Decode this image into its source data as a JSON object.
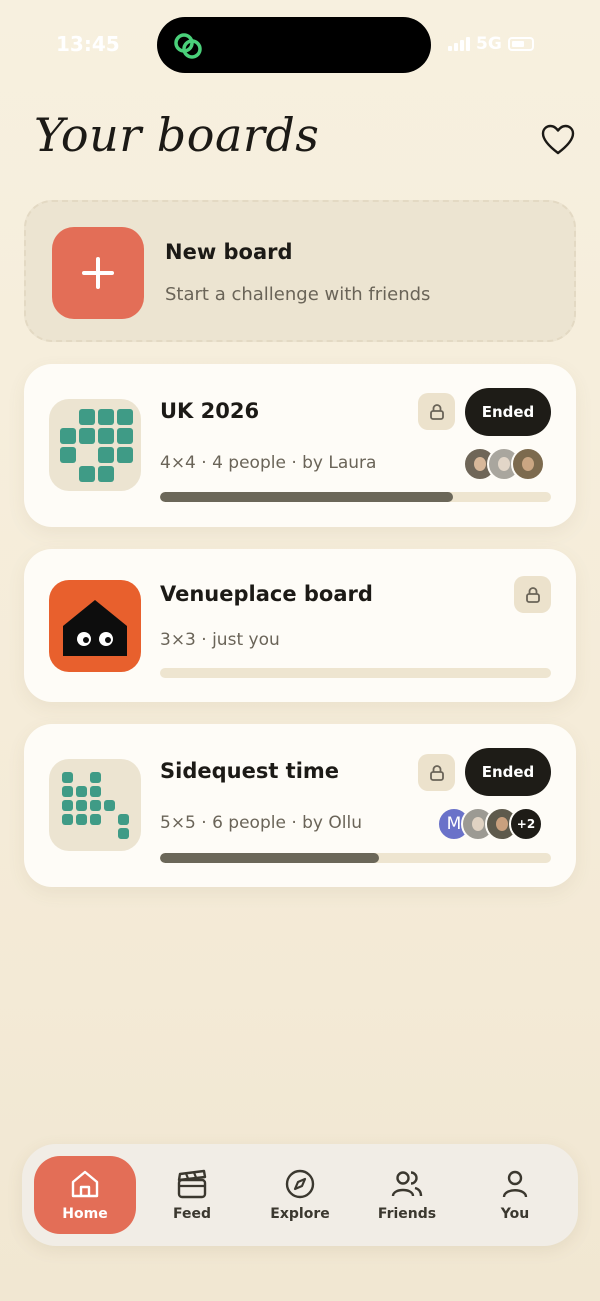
{
  "status": {
    "time": "13:45",
    "network": "5G"
  },
  "header": {
    "title": "Your boards"
  },
  "new_board": {
    "title": "New board",
    "subtitle": "Start a challenge with friends"
  },
  "boards": [
    {
      "title": "UK 2026",
      "meta": "4×4 · 4 people · by Laura",
      "status": "Ended",
      "progress": 0.75,
      "avatars": [
        "photo",
        "photo",
        "photo"
      ]
    },
    {
      "title": "Venueplace board",
      "meta": "3×3 · just you",
      "progress": 0.0
    },
    {
      "title": "Sidequest time",
      "meta": "5×5 · 6 people · by Ollu",
      "status": "Ended",
      "progress": 0.56,
      "avatar_letter": "M",
      "extra_count": "+2"
    }
  ],
  "tabs": [
    {
      "label": "Home",
      "icon": "home-icon",
      "active": true
    },
    {
      "label": "Feed",
      "icon": "clapperboard-icon",
      "active": false
    },
    {
      "label": "Explore",
      "icon": "compass-icon",
      "active": false
    },
    {
      "label": "Friends",
      "icon": "friends-icon",
      "active": false
    },
    {
      "label": "You",
      "icon": "person-icon",
      "active": false
    }
  ],
  "colors": {
    "accent": "#e36e57",
    "grid": "#3f9b86",
    "venue": "#e8602d",
    "dark": "#1e1c17"
  }
}
